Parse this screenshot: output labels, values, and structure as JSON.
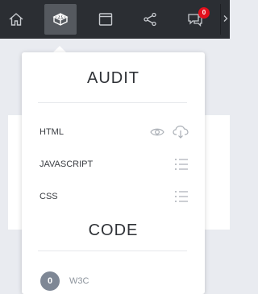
{
  "toolbar": {
    "items": [
      {
        "icon": "home-icon"
      },
      {
        "icon": "code-blocks-icon",
        "active": true
      },
      {
        "icon": "window-icon"
      },
      {
        "icon": "share-icon"
      },
      {
        "icon": "comments-icon",
        "badge": "0"
      }
    ],
    "more_icon": "chevron-right-icon"
  },
  "dropdown": {
    "audit": {
      "title": "AUDIT",
      "rows": [
        {
          "label": "HTML",
          "icons": [
            "eye-icon",
            "cloud-download-icon"
          ]
        },
        {
          "label": "JAVASCRIPT",
          "icons": [
            "list-icon"
          ]
        },
        {
          "label": "CSS",
          "icons": [
            "list-icon"
          ]
        }
      ]
    },
    "code": {
      "title": "CODE",
      "w3c": {
        "count": "0",
        "label": "W3C"
      }
    }
  },
  "colors": {
    "toolbar_bg": "#2b2e33",
    "active_button": "#55595f",
    "badge": "#e3101c",
    "page_bg": "#e9ebf0"
  }
}
